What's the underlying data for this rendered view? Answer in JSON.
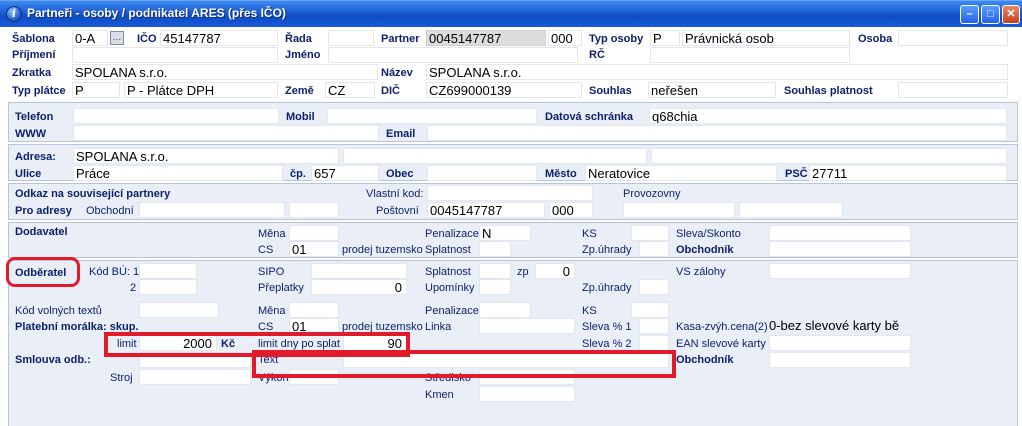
{
  "window": {
    "title": "Partneři - osoby / podnikatel ARES (přes IČO)"
  },
  "header": {
    "sablona_label": "Šablona",
    "sablona_value": "0-A",
    "ico_label": "IČO",
    "ico_value": "45147787",
    "rada_label": "Řada",
    "partner_label": "Partner",
    "partner_value": "0045147787",
    "partner_suffix": "000",
    "typ_osoby_label": "Typ osoby",
    "typ_osoby_code": "P",
    "typ_osoby_value": "Právnická osob",
    "osoba_label": "Osoba",
    "prijmeni_label": "Příjmení",
    "jmeno_label": "Jméno",
    "rc_label": "RČ",
    "zkratka_label": "Zkratka",
    "zkratka_value": "SPOLANA s.r.o.",
    "nazev_label": "Název",
    "nazev_value": "SPOLANA s.r.o.",
    "typ_platce_label": "Typ plátce",
    "typ_platce_code": "P",
    "typ_platce_value": "P - Plátce DPH",
    "zeme_label": "Země",
    "zeme_value": "CZ",
    "dic_label": "DIČ",
    "dic_value": "CZ699000139",
    "souhlas_label": "Souhlas",
    "souhlas_value": "neřešen",
    "souhlas_platnost_label": "Souhlas platnost"
  },
  "contact": {
    "telefon_label": "Telefon",
    "mobil_label": "Mobil",
    "datova_label": "Datová schránka",
    "datova_value": "q68chia",
    "www_label": "WWW",
    "email_label": "Email"
  },
  "address": {
    "adresa_label": "Adresa:",
    "adresa_value": "SPOLANA s.r.o.",
    "ulice_label": "Ulice",
    "ulice_value": "Práce",
    "cp_label": "čp.",
    "cp_value": "657",
    "obec_label": "Obec",
    "mesto_label": "Město",
    "mesto_value": "Neratovice",
    "psc_label": "PSČ",
    "psc_value": "27711"
  },
  "links": {
    "odkaz_label": "Odkaz na související partnery",
    "vlastni_kod_label": "Vlastní kod:",
    "provozovny_label": "Provozovny",
    "pro_adresy_label": "Pro adresy",
    "obchodni_label": "Obchodní",
    "postovni_label": "Poštovní",
    "postovni_value": "0045147787",
    "postovni_suffix": "000"
  },
  "dodavatel": {
    "title": "Dodavatel",
    "mena_label": "Měna",
    "cs_label": "CS",
    "cs_value": "01",
    "cs_text": "prodej tuzemsko",
    "penalizace_label": "Penalizace",
    "penalizace_value": "N",
    "splatnost_label": "Splatnost",
    "ks_label": "KS",
    "zp_uhrady_label": "Zp.úhrady",
    "sleva_skonto_label": "Sleva/Skonto",
    "obchodnik_label": "Obchodník"
  },
  "odberatel": {
    "title": "Odběratel",
    "kod_bu_label": "Kód BÚ: 1",
    "kod_bu_2": "2",
    "sipo_label": "SIPO",
    "preplatky_label": "Přeplatky",
    "preplatky_value": "0",
    "splatnost_label": "Splatnost",
    "zp_label": "zp",
    "zp_value": "0",
    "upominky_label": "Upomínky",
    "zp_uhrady_label": "Zp.úhrady",
    "vs_zalohy_label": "VS zálohy",
    "kod_volnych_label": "Kód volných textů",
    "mena_label": "Měna",
    "penalizace_label": "Penalizace",
    "ks_label": "KS",
    "platebni_label": "Platební morálka: skup.",
    "cs_label": "CS",
    "cs_value": "01",
    "cs_text": "prodej tuzemsko",
    "linka_label": "Linka",
    "sleva1_label": "Sleva % 1",
    "kasa_label": "Kasa-zvýh.cena(2)",
    "kasa_value": "0-bez slevové karty bě",
    "limit_label": "limit",
    "limit_value": "2000",
    "limit_unit": "Kč",
    "limit_dny_label": "limit dny po splat",
    "limit_dny_value": "90",
    "sleva2_label": "Sleva % 2",
    "ean_label": "EAN slevové karty",
    "smlouva_label": "Smlouva odb.:",
    "text_label": "Text",
    "obchodnik_label": "Obchodník",
    "stroj_label": "Stroj",
    "vykon_label": "Výkon",
    "stredisko_label": "Středisko",
    "kmen_label": "Kmen"
  },
  "colors": {
    "highlight": "#e21b2c",
    "label_blue": "#0c1f6b",
    "panel_bg": "#e9eef7"
  }
}
